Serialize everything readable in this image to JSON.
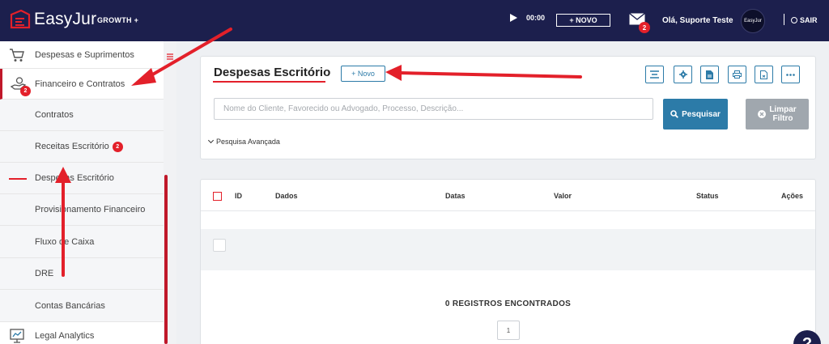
{
  "header": {
    "brand": "EasyJur",
    "plan": "GROWTH +",
    "timer": "00:00",
    "new_label": "+ NOVO",
    "mail_badge": "2",
    "greeting": "Olá, Suporte Teste",
    "avatar_text": "EasyJur",
    "logout_label": "SAIR"
  },
  "sidebar": {
    "items": [
      {
        "label": "Despesas e Suprimentos",
        "icon": "cart-icon"
      },
      {
        "label": "Financeiro e Contratos",
        "icon": "money-hand-icon",
        "badge": "2"
      },
      {
        "label": "Contratos"
      },
      {
        "label": "Receitas Escritório",
        "badge": "2"
      },
      {
        "label": "Despesas Escritório"
      },
      {
        "label": "Provisionamento Financeiro"
      },
      {
        "label": "Fluxo de Caixa"
      },
      {
        "label": "DRE"
      },
      {
        "label": "Contas Bancárias"
      },
      {
        "label": "Legal Analytics",
        "icon": "analytics-icon"
      }
    ]
  },
  "main": {
    "title": "Despesas Escritório",
    "new_button": "+ Novo",
    "search_placeholder": "Nome do Cliente, Favorecido ou Advogado, Processo, Descrição...",
    "search_button": "Pesquisar",
    "clear_button_line1": "Limpar",
    "clear_button_line2": "Filtro",
    "advanced_search": "Pesquisa Avançada",
    "toolbar_icons": [
      "columns-icon",
      "settings-icon",
      "file-icon",
      "print-icon",
      "export-icon",
      "more-icon"
    ]
  },
  "table": {
    "columns": [
      "ID",
      "Dados",
      "Datas",
      "Valor",
      "Status",
      "Ações"
    ],
    "records_text": "0 REGISTROS ENCONTRADOS",
    "page": "1"
  },
  "colors": {
    "topbar": "#1c1f4d",
    "accent_red": "#e3202a",
    "primary_blue": "#2c7ba8",
    "clear_gray": "#a0a7ae"
  }
}
